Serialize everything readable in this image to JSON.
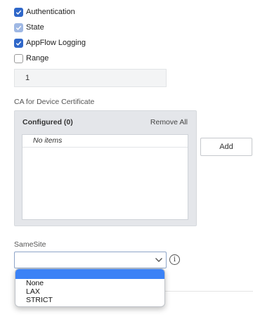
{
  "checkboxes": [
    {
      "label": "Authentication",
      "state": "checked"
    },
    {
      "label": "State",
      "state": "checked-disabled"
    },
    {
      "label": "AppFlow Logging",
      "state": "checked"
    },
    {
      "label": "Range",
      "state": "unchecked"
    }
  ],
  "range_input": {
    "value": "1"
  },
  "ca_section": {
    "label": "CA for Device Certificate",
    "configured_title": "Configured (0)",
    "remove_all_label": "Remove All",
    "empty_text": "No items",
    "add_label": "Add"
  },
  "samesite": {
    "label": "SameSite",
    "selected_value": "",
    "options": [
      "None",
      "LAX",
      "STRICT"
    ]
  },
  "colors": {
    "accent": "#2f67c9",
    "highlight": "#3b82f6",
    "panel_bg": "#e4e6ea"
  }
}
